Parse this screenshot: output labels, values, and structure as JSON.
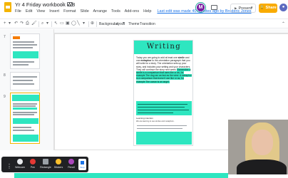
{
  "window": {
    "doc_title": "Yr 4 Friday workbook W8",
    "menu": [
      "File",
      "Edit",
      "View",
      "Insert",
      "Format",
      "Slide",
      "Arrange",
      "Tools",
      "Add-ons",
      "Help"
    ],
    "last_edit": "Last edit was made 40 minutes ago by Broderic Jones",
    "present_label": "Present",
    "share_label": "Share",
    "avatar_letter": "M",
    "colors": {
      "share": "#f9ab00",
      "accent_teal": "#2ee6c0",
      "avatar": "#7b1fa2"
    }
  },
  "toolbar": {
    "background_label": "Background",
    "layout_label": "Layout",
    "theme_label": "Theme",
    "transition_label": "Transition"
  },
  "filmstrip": {
    "slides": [
      {
        "number": "7"
      },
      {
        "number": "8"
      },
      {
        "number": "9"
      }
    ]
  },
  "slide": {
    "heading": "Writing",
    "intro_parts": [
      "Today you are going to add at least one ",
      "simile",
      " and one ",
      "metaphor",
      " to the orientation paragraph that you will write for a story. The orientation sets up your story, and includes your setting and your characters. They will continue the story next week."
    ],
    "highlight_text": "Remember a simile is a comparison that uses like or as, for example The dog ran as fast as the wind. A metaphor is a comparison that doesn't use like or as, for example The ocean is an angel.",
    "lesson_heading": "Learning intention",
    "lesson_line": "We are learning to use similes and metaphors."
  },
  "screencast": {
    "items": [
      {
        "label": "Webcam",
        "color": "#e8eaed"
      },
      {
        "label": "Pen",
        "color": "#e53935"
      },
      {
        "label": "Rectangle",
        "color": "#9aa0a6"
      },
      {
        "label": "Stickers",
        "color": "#fbc02d"
      },
      {
        "label": "Pencil",
        "color": "#ab47bc"
      }
    ],
    "stop_label": "Stop"
  }
}
